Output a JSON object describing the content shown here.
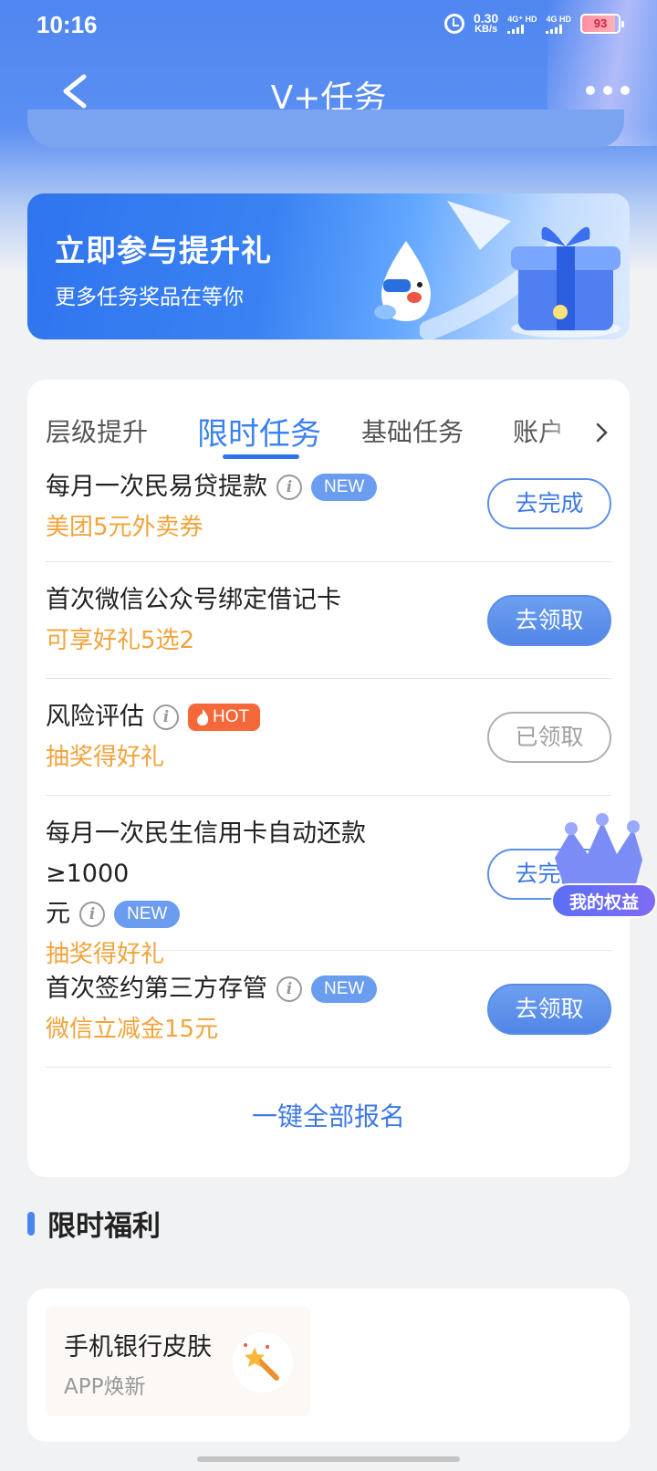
{
  "status_bar": {
    "time": "10:16",
    "net_speed_value": "0.30",
    "net_speed_unit": "KB/s",
    "signal1_label": "4G⁺ HD",
    "signal2_label": "4G HD",
    "battery": "93"
  },
  "nav": {
    "title": "V+任务",
    "back_icon": "chevron-left-icon",
    "more_icon": "more-dots-icon"
  },
  "banner": {
    "title": "立即参与提升礼",
    "subtitle": "更多任务奖品在等你"
  },
  "tabs": [
    {
      "label": "层级提升",
      "active": false
    },
    {
      "label": "限时任务",
      "active": true
    },
    {
      "label": "基础任务",
      "active": false
    },
    {
      "label": "账户",
      "active": false
    }
  ],
  "tasks": [
    {
      "title": "每月一次民易贷提款",
      "badge": "NEW",
      "reward": "美团5元外卖券",
      "button": "去完成"
    },
    {
      "title": "首次微信公众号绑定借记卡",
      "badge": "",
      "reward": "可享好礼5选2",
      "button": "去领取"
    },
    {
      "title": "风险评估",
      "badge": "HOT",
      "reward": "抽奖得好礼",
      "button": "已领取"
    },
    {
      "title_line1": "每月一次民生信用卡自动还款≥1000",
      "title_line2": "元",
      "badge": "NEW",
      "reward": "抽奖得好礼",
      "button": "去完成"
    },
    {
      "title": "首次签约第三方存管",
      "badge": "NEW",
      "reward": "微信立减金15元",
      "button": "去领取"
    }
  ],
  "signup_all": "一键全部报名",
  "float_rights": {
    "label": "我的权益"
  },
  "benefits": {
    "section_title": "限时福利",
    "items": [
      {
        "title": "手机银行皮肤",
        "subtitle": "APP焕新"
      }
    ]
  },
  "colors": {
    "accent": "#3a82f0",
    "reward": "#f2a33a",
    "new_badge": "#6a9cf0",
    "hot_badge": "#f4683a"
  }
}
